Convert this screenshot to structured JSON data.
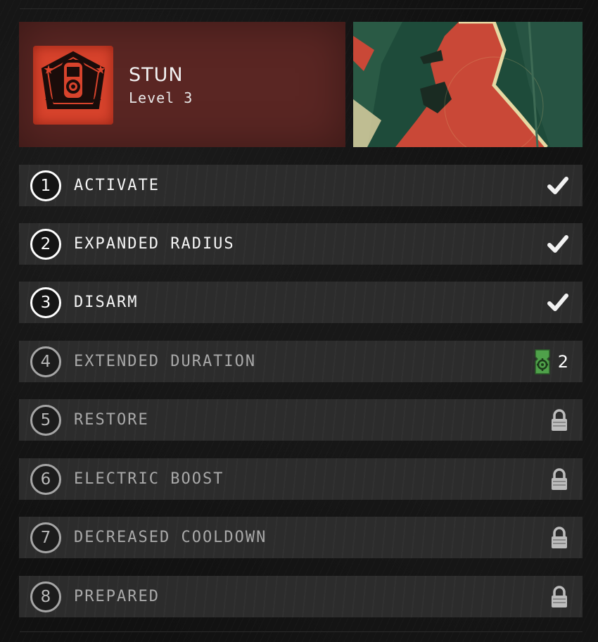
{
  "skill": {
    "name": "STUN",
    "level": "Level 3",
    "icon": "stun-device-icon",
    "accent": "#d8432c"
  },
  "upgrades": [
    {
      "number": "1",
      "label": "ACTIVATE",
      "status": "unlocked",
      "status_icon": "checkmark-icon"
    },
    {
      "number": "2",
      "label": "EXPANDED RADIUS",
      "status": "unlocked",
      "status_icon": "checkmark-icon"
    },
    {
      "number": "3",
      "label": "DISARM",
      "status": "unlocked",
      "status_icon": "checkmark-icon"
    },
    {
      "number": "4",
      "label": "EXTENDED DURATION",
      "status": "available",
      "status_icon": "upgrade-token-icon",
      "cost": "2"
    },
    {
      "number": "5",
      "label": "RESTORE",
      "status": "locked",
      "status_icon": "lock-icon"
    },
    {
      "number": "6",
      "label": "ELECTRIC BOOST",
      "status": "locked",
      "status_icon": "lock-icon"
    },
    {
      "number": "7",
      "label": "DECREASED COOLDOWN",
      "status": "locked",
      "status_icon": "lock-icon"
    },
    {
      "number": "8",
      "label": "PREPARED",
      "status": "locked",
      "status_icon": "lock-icon"
    }
  ],
  "colors": {
    "header_bg": "#5a2623",
    "row_bg": "#2c2c2c",
    "token_green": "#4fa14a"
  }
}
